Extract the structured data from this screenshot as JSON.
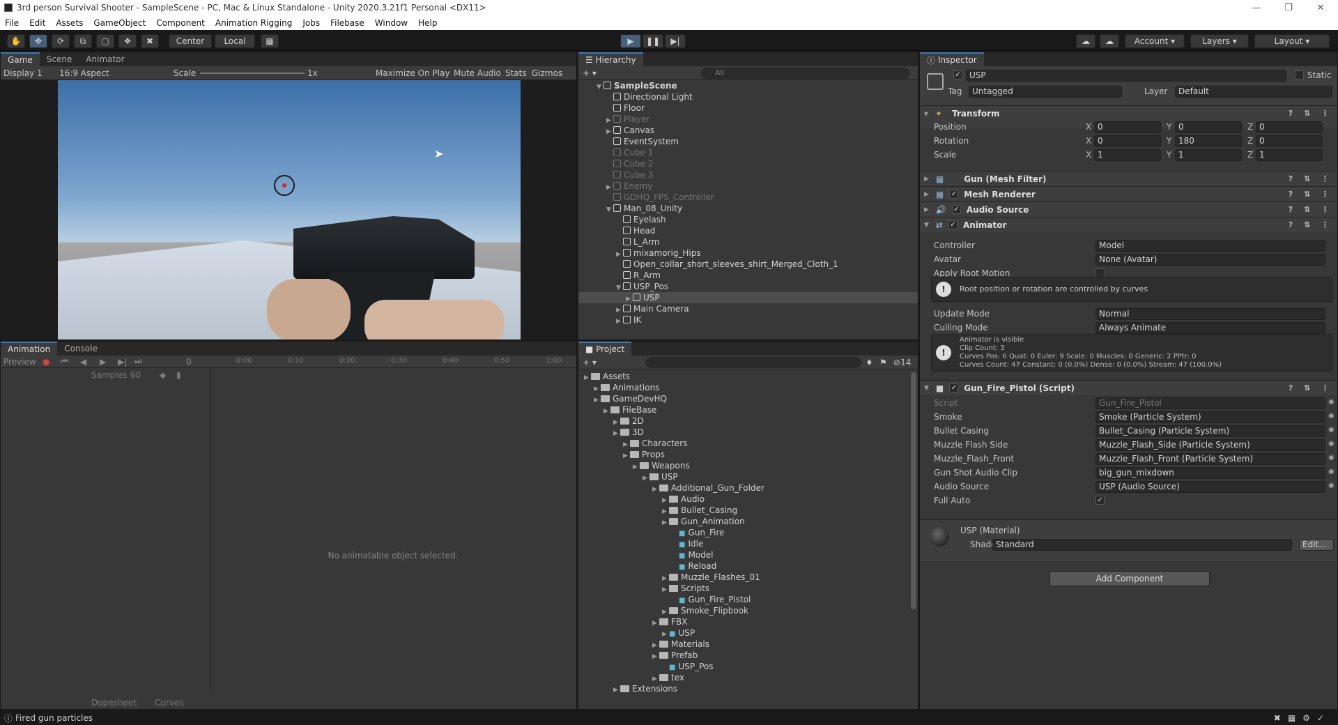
{
  "window": {
    "title": "3rd person Survival Shooter - SampleScene - PC, Mac & Linux Standalone - Unity 2020.3.21f1 Personal <DX11>"
  },
  "menu": [
    "File",
    "Edit",
    "Assets",
    "GameObject",
    "Component",
    "Animation Rigging",
    "Jobs",
    "Filebase",
    "Window",
    "Help"
  ],
  "toolbar": {
    "center": "Center",
    "local": "Local",
    "account": "Account",
    "layers": "Layers",
    "layout": "Layout"
  },
  "game": {
    "tabs": [
      "Game",
      "Scene",
      "Animator"
    ],
    "display": "Display 1",
    "aspect": "16:9 Aspect",
    "scale_label": "Scale",
    "scale_value": "1x",
    "maximize": "Maximize On Play",
    "mute": "Mute Audio",
    "stats": "Stats",
    "gizmos": "Gizmos"
  },
  "hierarchy": {
    "title": "Hierarchy",
    "search_placeholder": "All",
    "items": [
      {
        "label": "SampleScene",
        "depth": 0,
        "state": "scene"
      },
      {
        "label": "Directional Light",
        "depth": 1,
        "state": "normal"
      },
      {
        "label": "Floor",
        "depth": 1,
        "state": "normal"
      },
      {
        "label": "Player",
        "depth": 1,
        "state": "dim"
      },
      {
        "label": "Canvas",
        "depth": 1,
        "state": "normal"
      },
      {
        "label": "EventSystem",
        "depth": 1,
        "state": "normal"
      },
      {
        "label": "Cube 1",
        "depth": 1,
        "state": "dim"
      },
      {
        "label": "Cube 2",
        "depth": 1,
        "state": "dim"
      },
      {
        "label": "Cube 3",
        "depth": 1,
        "state": "dim"
      },
      {
        "label": "Enemy",
        "depth": 1,
        "state": "dim"
      },
      {
        "label": "GDHQ_FPS_Controller",
        "depth": 1,
        "state": "dim"
      },
      {
        "label": "Man_08_Unity",
        "depth": 1,
        "state": "normal"
      },
      {
        "label": "Eyelash",
        "depth": 2,
        "state": "normal"
      },
      {
        "label": "Head",
        "depth": 2,
        "state": "normal"
      },
      {
        "label": "L_Arm",
        "depth": 2,
        "state": "normal"
      },
      {
        "label": "mixamorig_Hips",
        "depth": 2,
        "state": "normal"
      },
      {
        "label": "Open_collar_short_sleeves_shirt_Merged_Cloth_1",
        "depth": 2,
        "state": "normal"
      },
      {
        "label": "R_Arm",
        "depth": 2,
        "state": "normal"
      },
      {
        "label": "USP_Pos",
        "depth": 2,
        "state": "normal"
      },
      {
        "label": "USP",
        "depth": 3,
        "state": "selected"
      },
      {
        "label": "Main Camera",
        "depth": 2,
        "state": "normal"
      },
      {
        "label": "IK",
        "depth": 2,
        "state": "normal"
      }
    ]
  },
  "animation": {
    "tabs": [
      "Animation",
      "Console"
    ],
    "preview": "Preview",
    "frame": "0",
    "samples_label": "Samples",
    "samples_value": "60",
    "ticks": [
      "0:00",
      "0:10",
      "0:20",
      "0:30",
      "0:40",
      "0:50",
      "1:00"
    ],
    "empty_message": "No animatable object selected.",
    "bottom_tabs": [
      "Dopesheet",
      "Curves"
    ]
  },
  "project": {
    "title": "Project",
    "hidden_count": "14",
    "items": [
      {
        "label": "Assets",
        "depth": 0
      },
      {
        "label": "Animations",
        "depth": 1
      },
      {
        "label": "GameDevHQ",
        "depth": 1
      },
      {
        "label": "FileBase",
        "depth": 2
      },
      {
        "label": "2D",
        "depth": 3
      },
      {
        "label": "3D",
        "depth": 3
      },
      {
        "label": "Characters",
        "depth": 4
      },
      {
        "label": "Props",
        "depth": 4
      },
      {
        "label": "Weapons",
        "depth": 5
      },
      {
        "label": "USP",
        "depth": 6
      },
      {
        "label": "Additional_Gun_Folder",
        "depth": 7
      },
      {
        "label": "Audio",
        "depth": 8
      },
      {
        "label": "Bullet_Casing",
        "depth": 8
      },
      {
        "label": "Gun_Animation",
        "depth": 8
      },
      {
        "label": "Gun_Fire",
        "depth": 9
      },
      {
        "label": "Idle",
        "depth": 9
      },
      {
        "label": "Model",
        "depth": 9
      },
      {
        "label": "Reload",
        "depth": 9
      },
      {
        "label": "Muzzle_Flashes_01",
        "depth": 8
      },
      {
        "label": "Scripts",
        "depth": 8
      },
      {
        "label": "Gun_Fire_Pistol",
        "depth": 9
      },
      {
        "label": "Smoke_Flipbook",
        "depth": 8
      },
      {
        "label": "FBX",
        "depth": 7
      },
      {
        "label": "USP",
        "depth": 8
      },
      {
        "label": "Materials",
        "depth": 7
      },
      {
        "label": "Prefab",
        "depth": 7
      },
      {
        "label": "USP_Pos",
        "depth": 8
      },
      {
        "label": "tex",
        "depth": 7
      },
      {
        "label": "Extensions",
        "depth": 3
      }
    ]
  },
  "inspector": {
    "title": "Inspector",
    "object_name": "USP",
    "static_label": "Static",
    "tag_label": "Tag",
    "tag_value": "Untagged",
    "layer_label": "Layer",
    "layer_value": "Default",
    "transform": {
      "title": "Transform",
      "position_label": "Position",
      "pos": [
        "0",
        "0",
        "0"
      ],
      "rotation_label": "Rotation",
      "rot": [
        "0",
        "180",
        "0"
      ],
      "scale_label": "Scale",
      "scl": [
        "1",
        "1",
        "1"
      ]
    },
    "components": [
      "Gun (Mesh Filter)",
      "Mesh Renderer",
      "Audio Source",
      "Animator"
    ],
    "animator": {
      "controller_label": "Controller",
      "controller_value": "Model",
      "avatar_label": "Avatar",
      "avatar_value": "None (Avatar)",
      "root_motion_label": "Apply Root Motion",
      "root_info": "Root position or rotation are controlled by curves",
      "update_label": "Update Mode",
      "update_value": "Normal",
      "culling_label": "Culling Mode",
      "culling_value": "Always Animate",
      "info_lines": [
        "Animator is visible",
        "Clip Count: 3",
        "Curves Pos: 6 Quat: 0 Euler: 9 Scale: 0 Muscles: 0 Generic: 2 PPtr: 0",
        "Curves Count: 47 Constant: 0 (0.0%) Dense: 0 (0.0%) Stream: 47 (100.0%)"
      ]
    },
    "script": {
      "title": "Gun_Fire_Pistol (Script)",
      "fields": [
        {
          "label": "Script",
          "value": "Gun_Fire_Pistol"
        },
        {
          "label": "Smoke",
          "value": "Smoke (Particle System)"
        },
        {
          "label": "Bullet Casing",
          "value": "Bullet_Casing (Particle System)"
        },
        {
          "label": "Muzzle Flash Side",
          "value": "Muzzle_Flash_Side (Particle System)"
        },
        {
          "label": "Muzzle_Flash_Front",
          "value": "Muzzle_Flash_Front (Particle System)"
        },
        {
          "label": "Gun Shot Audio Clip",
          "value": "big_gun_mixdown"
        },
        {
          "label": "Audio Source",
          "value": "USP (Audio Source)"
        }
      ],
      "full_auto_label": "Full Auto"
    },
    "material": {
      "title": "USP (Material)",
      "shader_label": "Shader",
      "shader_value": "Standard",
      "edit": "Edit..."
    },
    "add_component": "Add Component"
  },
  "status": {
    "message": "Fired gun particles"
  }
}
